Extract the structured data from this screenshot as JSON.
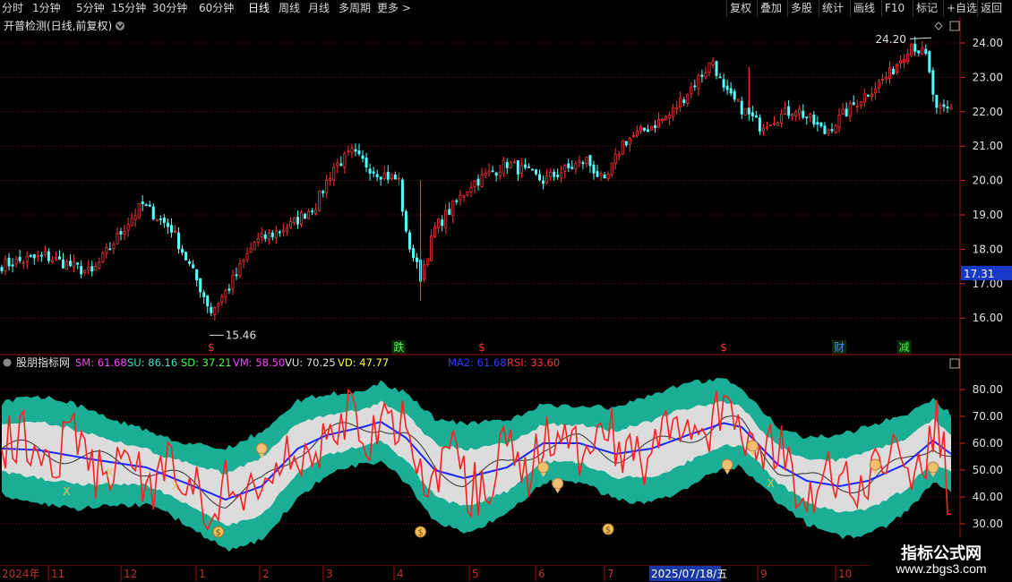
{
  "toolbar": {
    "periods": [
      "分时",
      "1分钟",
      "5分钟",
      "15分钟",
      "30分钟",
      "60分钟",
      "日线",
      "周线",
      "月线",
      "多周期",
      "更多 >"
    ],
    "active_period": "日线",
    "actions": [
      "复权",
      "叠加",
      "多股",
      "统计",
      "画线",
      "F10",
      "标记",
      "+自选",
      "返回"
    ]
  },
  "main_panel": {
    "title": "开普检测(日线,前复权)",
    "high_label": "24.20",
    "low_label": "15.46",
    "current_price": "17.31",
    "price_ticks": [
      "24.00",
      "23.00",
      "22.00",
      "21.00",
      "20.00",
      "19.00",
      "18.00",
      "17.00",
      "16.00"
    ],
    "event_markers": [
      {
        "text": "$",
        "color": "#ff3030",
        "date_index": 58
      },
      {
        "text": "跌",
        "color": "#40ff40",
        "date_index": 110
      },
      {
        "text": "$",
        "color": "#ff3030",
        "date_index": 133
      },
      {
        "text": "$",
        "color": "#ff3030",
        "date_index": 200
      },
      {
        "text": "财",
        "color": "#4090ff",
        "date_index": 232
      },
      {
        "text": "减",
        "color": "#40ff40",
        "date_index": 250
      }
    ]
  },
  "indicator_panel": {
    "title": "股朋指标网",
    "values": [
      {
        "label": "SM: 61.68",
        "color": "#ff40ff"
      },
      {
        "label": "SU: 86.16",
        "color": "#40e0d0"
      },
      {
        "label": "SD: 37.21",
        "color": "#40ff40"
      },
      {
        "label": "VM: 58.50",
        "color": "#ff40ff"
      },
      {
        "label": "VU: 70.25",
        "color": "#e0e0e0"
      },
      {
        "label": "VD: 47.77",
        "color": "#ffff40"
      },
      {
        "label": "MA2: 61.68",
        "color": "#3040ff"
      },
      {
        "label": "RSI: 33.60",
        "color": "#ff3030"
      }
    ],
    "ticks": [
      "80.00",
      "70.00",
      "60.00",
      "50.00",
      "40.00",
      "30.00"
    ]
  },
  "time_axis": {
    "labels": [
      "2024年",
      "11",
      "12",
      "1",
      "2",
      "3",
      "4",
      "5",
      "6",
      "7",
      "2025/07/18/五",
      "9",
      "10"
    ]
  },
  "watermark": {
    "line1": "指标公式网",
    "line2": "www.zbgs3.com"
  },
  "colors": {
    "up": "#ff3232",
    "down": "#54ffff",
    "band_outer": "#1aaf95",
    "band_inner": "#dcdcdc",
    "rsi": "#ff2020",
    "ma": "#1a28ff",
    "grid": "#7a1010"
  }
}
